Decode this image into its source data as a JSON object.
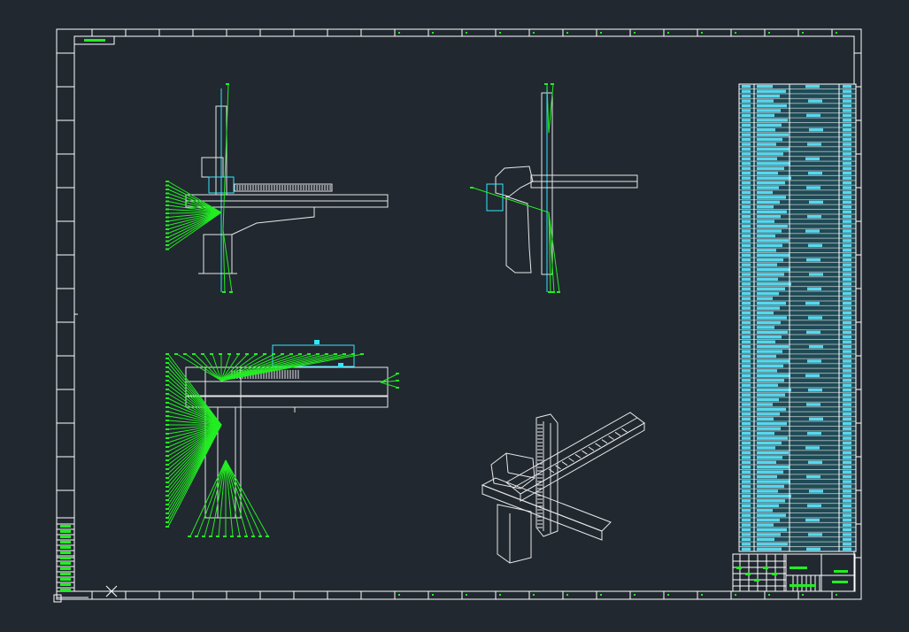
{
  "app": {
    "view": "model-space"
  },
  "colors": {
    "background": "#212830",
    "frame": "#ffffff",
    "leader": "#22ee22",
    "dimension": "#33e6ff",
    "part": "#e8e8e8",
    "bom_fill": "#57d8ee",
    "bom_grid": "#ffffff"
  },
  "drawing": {
    "views": [
      {
        "name": "front-view"
      },
      {
        "name": "side-view"
      },
      {
        "name": "top-view"
      },
      {
        "name": "isometric-view"
      }
    ],
    "parts_list": {
      "rows": 97
    },
    "title_block": {
      "present": true
    }
  },
  "icons": {
    "ucs": "ucs-icon",
    "viewport": "viewport-icon"
  }
}
